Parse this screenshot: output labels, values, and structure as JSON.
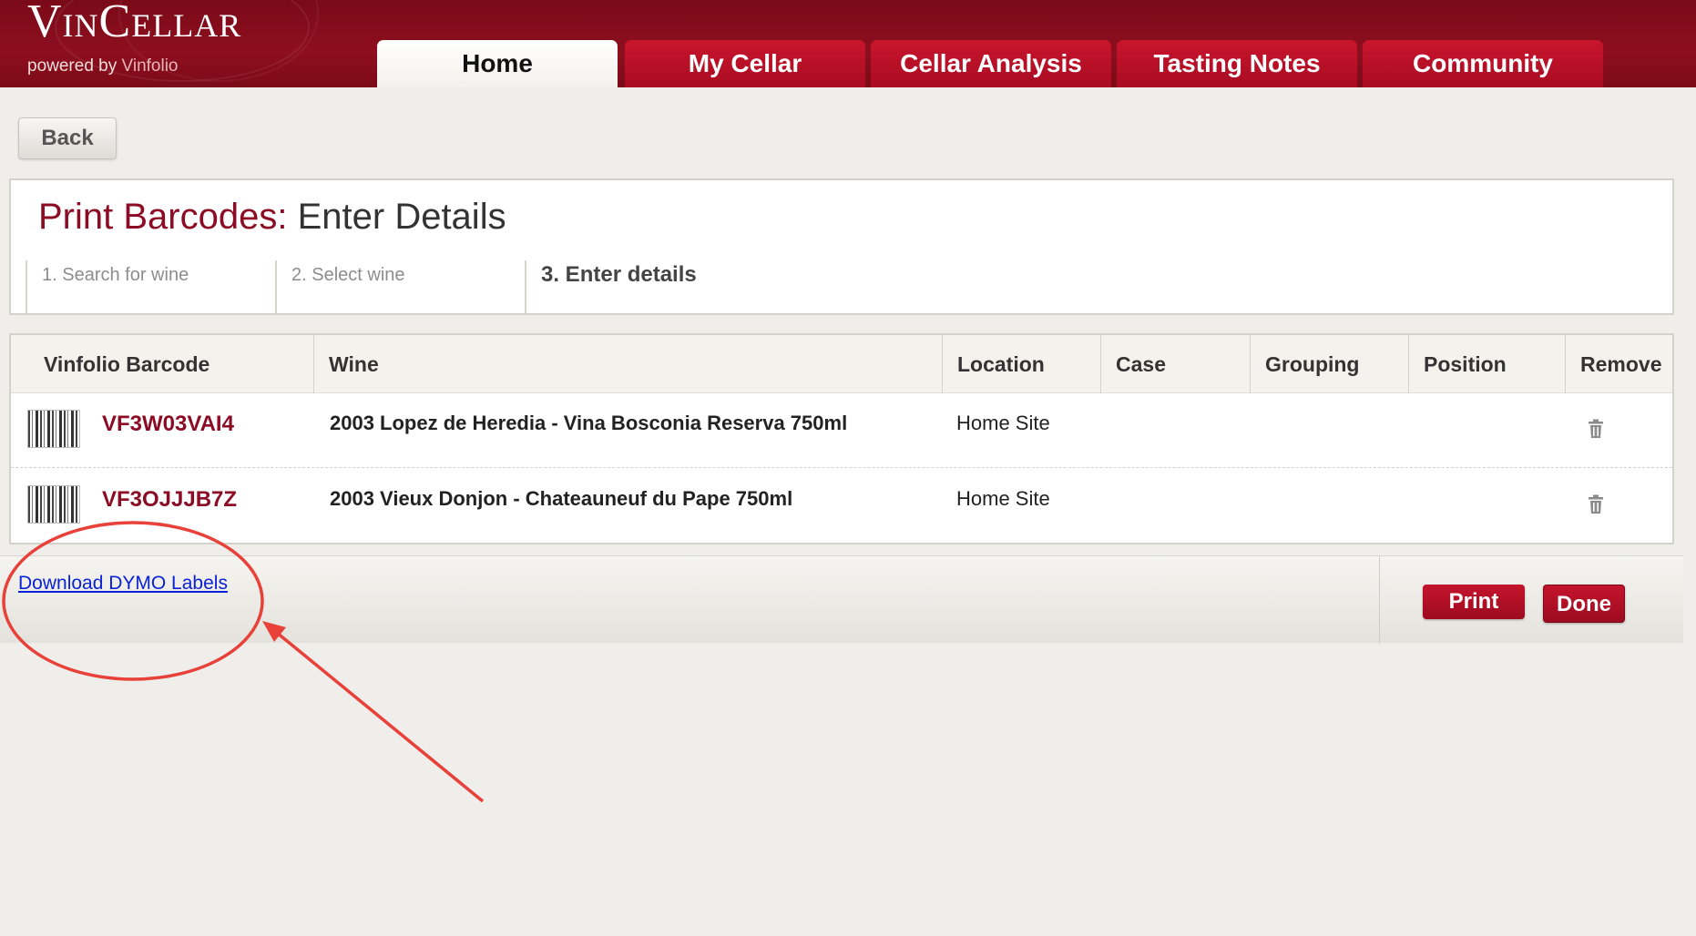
{
  "header": {
    "logo": "VinCellar",
    "logo_sub_prefix": "powered by ",
    "logo_sub_brand": "Vinfolio",
    "tabs": [
      {
        "label": "Home",
        "active": true
      },
      {
        "label": "My Cellar",
        "active": false
      },
      {
        "label": "Cellar Analysis",
        "active": false
      },
      {
        "label": "Tasting Notes",
        "active": false
      },
      {
        "label": "Community",
        "active": false
      }
    ]
  },
  "back_label": "Back",
  "panel": {
    "title_prefix": "Print Barcodes:",
    "title_suffix": "Enter Details",
    "steps": [
      "1. Search for wine",
      "2. Select wine",
      "3. Enter details"
    ],
    "current_step": 3
  },
  "table": {
    "columns": [
      "Vinfolio Barcode",
      "Wine",
      "Location",
      "Case",
      "Grouping",
      "Position",
      "Remove"
    ],
    "rows": [
      {
        "barcode": "VF3W03VAI4",
        "wine": "2003 Lopez de Heredia - Vina Bosconia Reserva 750ml",
        "location": "Home Site",
        "case": "",
        "grouping": "",
        "position": ""
      },
      {
        "barcode": "VF3OJJJB7Z",
        "wine": "2003 Vieux Donjon - Chateauneuf du Pape 750ml",
        "location": "Home Site",
        "case": "",
        "grouping": "",
        "position": ""
      }
    ]
  },
  "footer": {
    "download_link": "Download DYMO Labels",
    "print_label": "Print",
    "done_label": "Done"
  },
  "colors": {
    "brand": "#8e0f1f",
    "accent": "#c4142c",
    "link": "#0b22d6",
    "annotation": "#e8413a"
  },
  "icons": {
    "row_barcode": "barcode-icon",
    "remove": "trash-icon"
  }
}
